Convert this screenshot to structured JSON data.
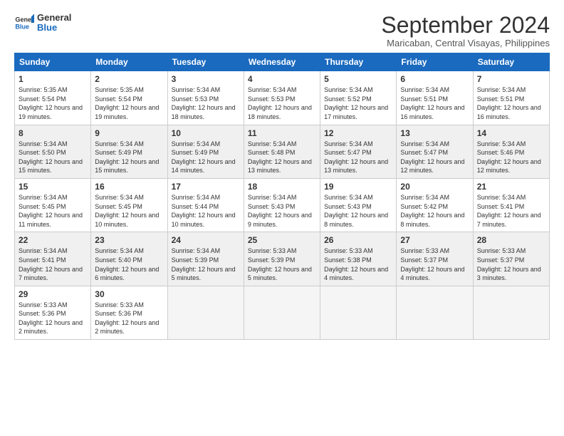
{
  "logo": {
    "line1": "General",
    "line2": "Blue"
  },
  "title": "September 2024",
  "location": "Maricaban, Central Visayas, Philippines",
  "headers": [
    "Sunday",
    "Monday",
    "Tuesday",
    "Wednesday",
    "Thursday",
    "Friday",
    "Saturday"
  ],
  "weeks": [
    [
      {
        "day": "1",
        "sunrise": "5:35 AM",
        "sunset": "5:54 PM",
        "daylight": "12 hours and 19 minutes."
      },
      {
        "day": "2",
        "sunrise": "5:35 AM",
        "sunset": "5:54 PM",
        "daylight": "12 hours and 19 minutes."
      },
      {
        "day": "3",
        "sunrise": "5:34 AM",
        "sunset": "5:53 PM",
        "daylight": "12 hours and 18 minutes."
      },
      {
        "day": "4",
        "sunrise": "5:34 AM",
        "sunset": "5:53 PM",
        "daylight": "12 hours and 18 minutes."
      },
      {
        "day": "5",
        "sunrise": "5:34 AM",
        "sunset": "5:52 PM",
        "daylight": "12 hours and 17 minutes."
      },
      {
        "day": "6",
        "sunrise": "5:34 AM",
        "sunset": "5:51 PM",
        "daylight": "12 hours and 16 minutes."
      },
      {
        "day": "7",
        "sunrise": "5:34 AM",
        "sunset": "5:51 PM",
        "daylight": "12 hours and 16 minutes."
      }
    ],
    [
      {
        "day": "8",
        "sunrise": "5:34 AM",
        "sunset": "5:50 PM",
        "daylight": "12 hours and 15 minutes."
      },
      {
        "day": "9",
        "sunrise": "5:34 AM",
        "sunset": "5:49 PM",
        "daylight": "12 hours and 15 minutes."
      },
      {
        "day": "10",
        "sunrise": "5:34 AM",
        "sunset": "5:49 PM",
        "daylight": "12 hours and 14 minutes."
      },
      {
        "day": "11",
        "sunrise": "5:34 AM",
        "sunset": "5:48 PM",
        "daylight": "12 hours and 13 minutes."
      },
      {
        "day": "12",
        "sunrise": "5:34 AM",
        "sunset": "5:47 PM",
        "daylight": "12 hours and 13 minutes."
      },
      {
        "day": "13",
        "sunrise": "5:34 AM",
        "sunset": "5:47 PM",
        "daylight": "12 hours and 12 minutes."
      },
      {
        "day": "14",
        "sunrise": "5:34 AM",
        "sunset": "5:46 PM",
        "daylight": "12 hours and 12 minutes."
      }
    ],
    [
      {
        "day": "15",
        "sunrise": "5:34 AM",
        "sunset": "5:45 PM",
        "daylight": "12 hours and 11 minutes."
      },
      {
        "day": "16",
        "sunrise": "5:34 AM",
        "sunset": "5:45 PM",
        "daylight": "12 hours and 10 minutes."
      },
      {
        "day": "17",
        "sunrise": "5:34 AM",
        "sunset": "5:44 PM",
        "daylight": "12 hours and 10 minutes."
      },
      {
        "day": "18",
        "sunrise": "5:34 AM",
        "sunset": "5:43 PM",
        "daylight": "12 hours and 9 minutes."
      },
      {
        "day": "19",
        "sunrise": "5:34 AM",
        "sunset": "5:43 PM",
        "daylight": "12 hours and 8 minutes."
      },
      {
        "day": "20",
        "sunrise": "5:34 AM",
        "sunset": "5:42 PM",
        "daylight": "12 hours and 8 minutes."
      },
      {
        "day": "21",
        "sunrise": "5:34 AM",
        "sunset": "5:41 PM",
        "daylight": "12 hours and 7 minutes."
      }
    ],
    [
      {
        "day": "22",
        "sunrise": "5:34 AM",
        "sunset": "5:41 PM",
        "daylight": "12 hours and 7 minutes."
      },
      {
        "day": "23",
        "sunrise": "5:34 AM",
        "sunset": "5:40 PM",
        "daylight": "12 hours and 6 minutes."
      },
      {
        "day": "24",
        "sunrise": "5:34 AM",
        "sunset": "5:39 PM",
        "daylight": "12 hours and 5 minutes."
      },
      {
        "day": "25",
        "sunrise": "5:33 AM",
        "sunset": "5:39 PM",
        "daylight": "12 hours and 5 minutes."
      },
      {
        "day": "26",
        "sunrise": "5:33 AM",
        "sunset": "5:38 PM",
        "daylight": "12 hours and 4 minutes."
      },
      {
        "day": "27",
        "sunrise": "5:33 AM",
        "sunset": "5:37 PM",
        "daylight": "12 hours and 4 minutes."
      },
      {
        "day": "28",
        "sunrise": "5:33 AM",
        "sunset": "5:37 PM",
        "daylight": "12 hours and 3 minutes."
      }
    ],
    [
      {
        "day": "29",
        "sunrise": "5:33 AM",
        "sunset": "5:36 PM",
        "daylight": "12 hours and 2 minutes."
      },
      {
        "day": "30",
        "sunrise": "5:33 AM",
        "sunset": "5:36 PM",
        "daylight": "12 hours and 2 minutes."
      },
      null,
      null,
      null,
      null,
      null
    ]
  ]
}
